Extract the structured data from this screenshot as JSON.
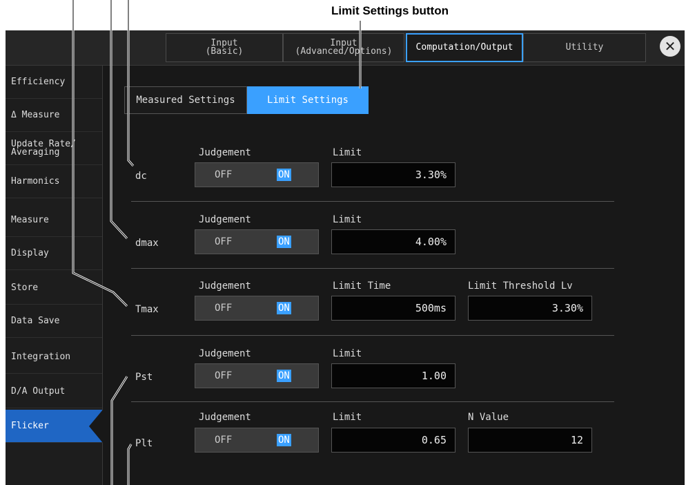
{
  "callout": {
    "label": "Limit Settings button"
  },
  "tabs": [
    {
      "label": "Input\n(Basic)"
    },
    {
      "label": "Input\n(Advanced/Options)"
    },
    {
      "label": "Computation/Output"
    },
    {
      "label": "Utility"
    }
  ],
  "close": {
    "glyph": "✕"
  },
  "sidebar": {
    "items": [
      {
        "label": "Efficiency"
      },
      {
        "label": "Δ Measure"
      },
      {
        "label": "Update Rate/\nAveraging"
      },
      {
        "label": "Harmonics"
      },
      {
        "label": "Measure"
      },
      {
        "label": "Display"
      },
      {
        "label": "Store"
      },
      {
        "label": "Data Save"
      },
      {
        "label": "Integration"
      },
      {
        "label": "D/A Output"
      },
      {
        "label": "Flicker"
      }
    ]
  },
  "segments": {
    "measured": "Measured Settings",
    "limit": "Limit Settings"
  },
  "toggle": {
    "off": "OFF",
    "on": "ON"
  },
  "rows": [
    {
      "name": "dc",
      "judgement": "Judgement",
      "field1_label": "Limit",
      "field1_value": "3.30%"
    },
    {
      "name": "dmax",
      "judgement": "Judgement",
      "field1_label": "Limit",
      "field1_value": "4.00%"
    },
    {
      "name": "Tmax",
      "judgement": "Judgement",
      "field1_label": "Limit Time",
      "field1_value": "500ms",
      "field2_label": "Limit Threshold Lv",
      "field2_value": "3.30%"
    },
    {
      "name": "Pst",
      "judgement": "Judgement",
      "field1_label": "Limit",
      "field1_value": "1.00"
    },
    {
      "name": "Plt",
      "judgement": "Judgement",
      "field1_label": "Limit",
      "field1_value": "0.65",
      "field2_label": "N Value",
      "field2_value": "12"
    }
  ]
}
